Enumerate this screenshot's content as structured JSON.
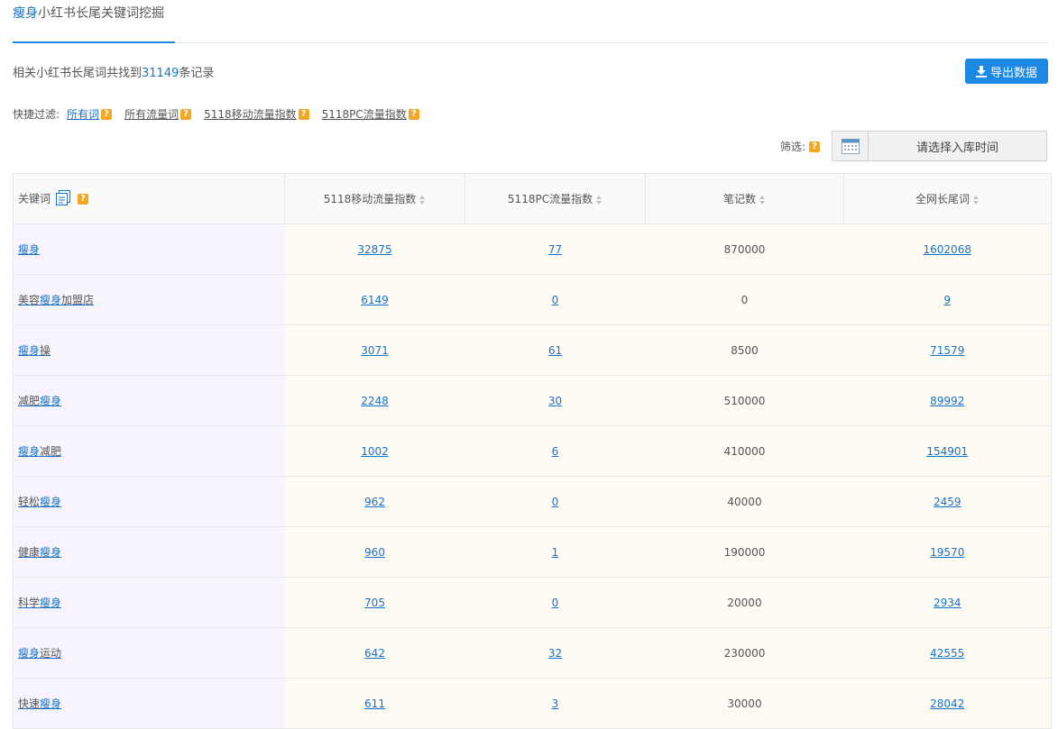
{
  "header": {
    "keyword": "瘦身",
    "title_rest": "小红书长尾关键词挖掘"
  },
  "summary": {
    "prefix": "相关小红书长尾词共找到",
    "count": "31149",
    "suffix": "条记录"
  },
  "export": {
    "label": "导出数据",
    "icon": "download-icon"
  },
  "quick_filter": {
    "label": "快捷过滤:",
    "options": [
      {
        "label": "所有词",
        "active": true
      },
      {
        "label": "所有流量词",
        "active": false
      },
      {
        "label": "5118移动流量指数",
        "active": false
      },
      {
        "label": "5118PC流量指数",
        "active": false
      }
    ]
  },
  "filter": {
    "label": "筛选:",
    "date_placeholder": "请选择入库时间"
  },
  "table": {
    "columns": [
      "关键词",
      "5118移动流量指数",
      "5118PC流量指数",
      "笔记数",
      "全网长尾词"
    ],
    "rows": [
      {
        "pre": "",
        "hl": "瘦身",
        "post": "",
        "mobile": "32875",
        "pc": "77",
        "notes": "870000",
        "longtail": "1602068"
      },
      {
        "pre": "美容",
        "hl": "瘦身",
        "post": "加盟店",
        "mobile": "6149",
        "pc": "0",
        "notes": "0",
        "longtail": "9"
      },
      {
        "pre": "",
        "hl": "瘦身",
        "post": "操",
        "mobile": "3071",
        "pc": "61",
        "notes": "8500",
        "longtail": "71579"
      },
      {
        "pre": "减肥",
        "hl": "瘦身",
        "post": "",
        "mobile": "2248",
        "pc": "30",
        "notes": "510000",
        "longtail": "89992"
      },
      {
        "pre": "",
        "hl": "瘦身",
        "post": "减肥",
        "mobile": "1002",
        "pc": "6",
        "notes": "410000",
        "longtail": "154901"
      },
      {
        "pre": "轻松",
        "hl": "瘦身",
        "post": "",
        "mobile": "962",
        "pc": "0",
        "notes": "40000",
        "longtail": "2459"
      },
      {
        "pre": "健康",
        "hl": "瘦身",
        "post": "",
        "mobile": "960",
        "pc": "1",
        "notes": "190000",
        "longtail": "19570"
      },
      {
        "pre": "科学",
        "hl": "瘦身",
        "post": "",
        "mobile": "705",
        "pc": "0",
        "notes": "20000",
        "longtail": "2934"
      },
      {
        "pre": "",
        "hl": "瘦身",
        "post": "运动",
        "mobile": "642",
        "pc": "32",
        "notes": "230000",
        "longtail": "42555"
      },
      {
        "pre": "快速",
        "hl": "瘦身",
        "post": "",
        "mobile": "611",
        "pc": "3",
        "notes": "30000",
        "longtail": "28042"
      }
    ]
  }
}
